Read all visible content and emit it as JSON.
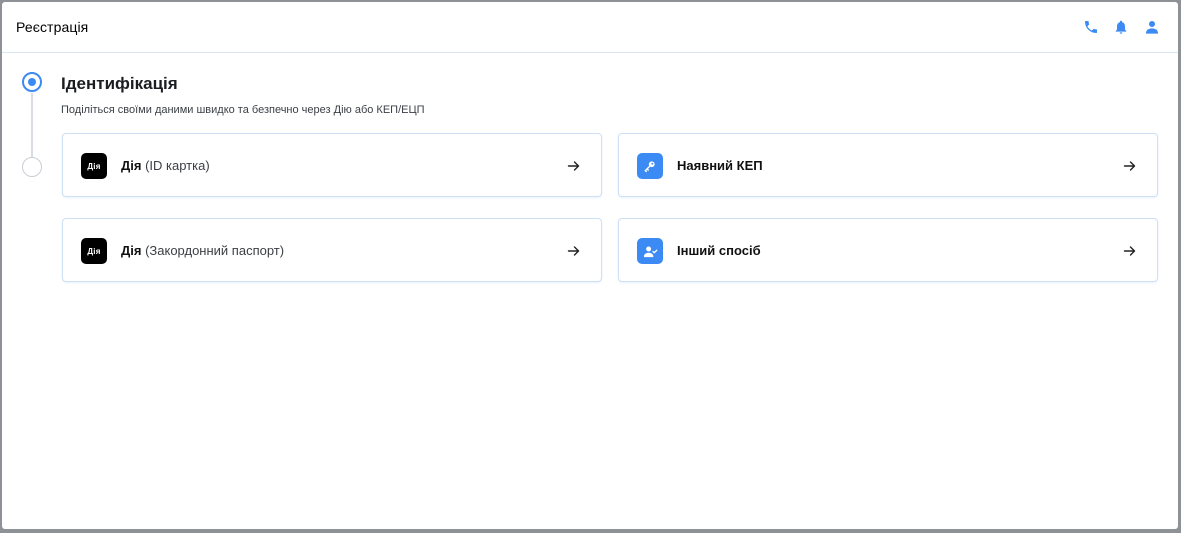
{
  "header": {
    "title": "Реєстрація",
    "icons": [
      "phone-icon",
      "bell-icon",
      "user-icon"
    ]
  },
  "step": {
    "title": "Ідентифікація",
    "subtitle": "Поділіться своїми даними швидко та безпечно через Дію або КЕП/ЕЦП"
  },
  "options": [
    {
      "icon": "diia-logo",
      "icon_text": "Дія",
      "label_bold": "Дія",
      "label_rest": " (ID картка)"
    },
    {
      "icon": "key-icon",
      "label_bold": "Наявний КЕП",
      "label_rest": ""
    },
    {
      "icon": "diia-logo",
      "icon_text": "Дія",
      "label_bold": "Дія",
      "label_rest": " (Закордонний паспорт)"
    },
    {
      "icon": "user-check-icon",
      "label_bold": "Інший спосіб",
      "label_rest": ""
    }
  ],
  "colors": {
    "accent": "#3c8af3",
    "border": "#cfdff4",
    "diia": "#000000"
  }
}
